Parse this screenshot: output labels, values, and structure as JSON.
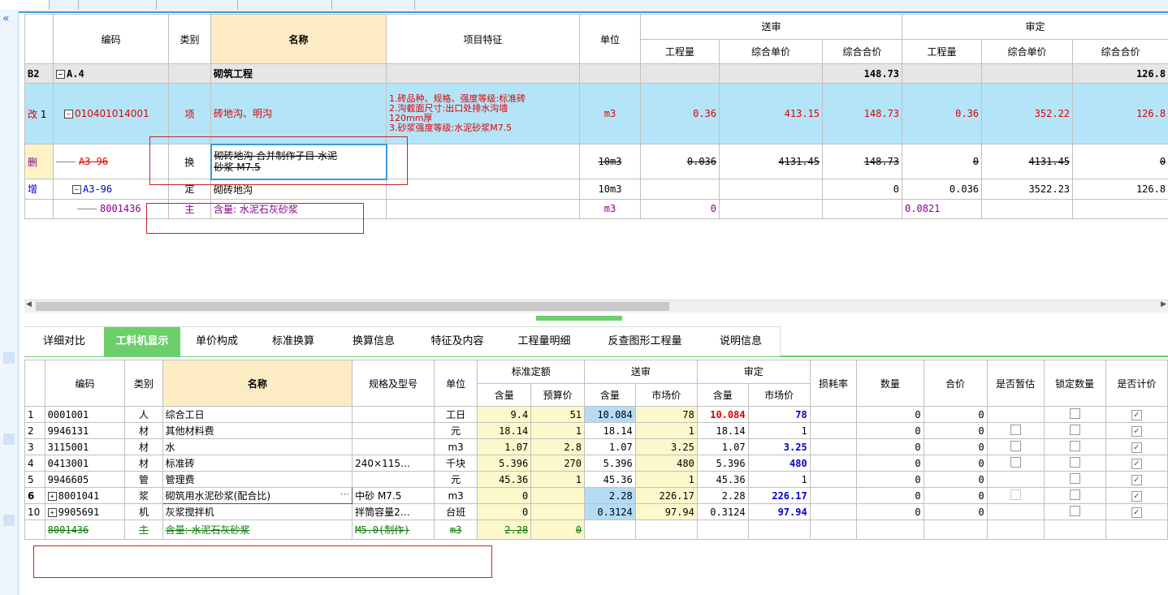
{
  "upper": {
    "headers": {
      "code": "编码",
      "type": "类别",
      "name": "名称",
      "feature": "项目特征",
      "unit": "单位",
      "sent": "送审",
      "approved": "审定",
      "qty": "工程量",
      "unit_price": "综合单价",
      "total": "综合合价"
    },
    "section": {
      "id": "B2",
      "code": "A.4",
      "name": "砌筑工程",
      "sent_total": "148.73",
      "approved_total": "126.8"
    },
    "item": {
      "mark": "改",
      "idx": "1",
      "code": "010401014001",
      "type": "项",
      "name": "砖地沟、明沟",
      "features": [
        "1.砖品种、规格、强度等级:标准砖",
        "2.沟截面尺寸:出口处排水沟墙",
        "120mm厚",
        "3.砂浆强度等级:水泥砂浆M7.5"
      ],
      "unit": "m3",
      "sent_qty": "0.36",
      "sent_price": "413.15",
      "sent_total": "148.73",
      "app_qty": "0.36",
      "app_price": "352.22",
      "app_total": "126.8"
    },
    "deleted": {
      "mark": "删",
      "code": "A3-96",
      "type": "换",
      "name_l1": "砌砖地沟  合并制作子目 水泥",
      "name_l2": "砂浆 M7.5",
      "unit": "10m3",
      "sent_qty": "0.036",
      "sent_price": "4131.45",
      "sent_total": "148.73",
      "app_qty": "0",
      "app_price": "4131.45",
      "app_total": "0"
    },
    "added": {
      "mark": "增",
      "code": "A3-96",
      "type": "定",
      "name": "砌砖地沟",
      "unit": "10m3",
      "sent_total": "0",
      "app_qty": "0.036",
      "app_price": "3522.23",
      "app_total": "126.8"
    },
    "material": {
      "code": "8001436",
      "type": "主",
      "name": "含量: 水泥石灰砂浆",
      "unit": "m3",
      "sent_qty": "0",
      "app_qty": "0.0821"
    }
  },
  "tabs": [
    "详细对比",
    "工料机显示",
    "单价构成",
    "标准换算",
    "换算信息",
    "特征及内容",
    "工程量明细",
    "反查图形工程量",
    "说明信息"
  ],
  "active_tab": "工料机显示",
  "lower": {
    "headers": {
      "code": "编码",
      "type": "类别",
      "name": "名称",
      "spec": "规格及型号",
      "unit": "单位",
      "std": "标准定额",
      "sent": "送审",
      "approved": "审定",
      "content": "含量",
      "budget": "预算价",
      "market": "市场价",
      "loss": "损耗率",
      "count": "数量",
      "sum": "合价",
      "temp": "是否暂估",
      "lock": "锁定数量",
      "priced": "是否计价"
    },
    "rows": [
      {
        "idx": "1",
        "code": "0001001",
        "type": "人",
        "name": "综合工日",
        "spec": "",
        "unit": "工日",
        "std_q": "9.4",
        "std_p": "51",
        "s_q": "10.084",
        "s_p": "78",
        "a_q": "10.084",
        "a_p": "78",
        "count": "0",
        "sum": "0"
      },
      {
        "idx": "2",
        "code": "9946131",
        "type": "材",
        "name": "其他材料费",
        "spec": "",
        "unit": "元",
        "std_q": "18.14",
        "std_p": "1",
        "s_q": "18.14",
        "s_p": "1",
        "a_q": "18.14",
        "a_p": "1",
        "count": "0",
        "sum": "0"
      },
      {
        "idx": "3",
        "code": "3115001",
        "type": "材",
        "name": "水",
        "spec": "",
        "unit": "m3",
        "std_q": "1.07",
        "std_p": "2.8",
        "s_q": "1.07",
        "s_p": "3.25",
        "a_q": "1.07",
        "a_p": "3.25",
        "count": "0",
        "sum": "0"
      },
      {
        "idx": "4",
        "code": "0413001",
        "type": "材",
        "name": "标准砖",
        "spec": "240×115…",
        "unit": "千块",
        "std_q": "5.396",
        "std_p": "270",
        "s_q": "5.396",
        "s_p": "480",
        "a_q": "5.396",
        "a_p": "480",
        "count": "0",
        "sum": "0"
      },
      {
        "idx": "5",
        "code": "9946605",
        "type": "管",
        "name": "管理费",
        "spec": "",
        "unit": "元",
        "std_q": "45.36",
        "std_p": "1",
        "s_q": "45.36",
        "s_p": "1",
        "a_q": "45.36",
        "a_p": "1",
        "count": "0",
        "sum": "0"
      },
      {
        "idx": "6",
        "code": "8001041",
        "type": "浆",
        "name": "砌筑用水泥砂浆(配合比)",
        "spec": "中砂 M7.5",
        "unit": "m3",
        "std_q": "0",
        "std_p": "",
        "s_q": "2.28",
        "s_p": "226.17",
        "a_q": "2.28",
        "a_p": "226.17",
        "count": "0",
        "sum": "0"
      },
      {
        "idx": "10",
        "code": "9905691",
        "type": "机",
        "name": "灰浆搅拌机",
        "spec": "拌筒容量2…",
        "unit": "台班",
        "std_q": "0",
        "std_p": "",
        "s_q": "0.3124",
        "s_p": "97.94",
        "a_q": "0.3124",
        "a_p": "97.94",
        "count": "0",
        "sum": "0"
      }
    ],
    "deleted_row": {
      "code": "8001436",
      "type": "主",
      "name": "含量: 水泥石灰砂浆",
      "spec": "M5.0(制作)",
      "unit": "m3",
      "std_q": "2.28",
      "std_p": "0"
    },
    "ellipsis": "···"
  },
  "colors": {
    "accent": "#3a9bd5",
    "tab_active": "#6ccf6c",
    "highlight": "#b4e4f8",
    "red": "#e00000",
    "blue": "#0000cc"
  },
  "icons": {
    "collapse": "double-chevron-left-icon",
    "expand": "plus-box-icon",
    "collapse_tree": "minus-box-icon",
    "check": "checkbox-checked-icon"
  }
}
